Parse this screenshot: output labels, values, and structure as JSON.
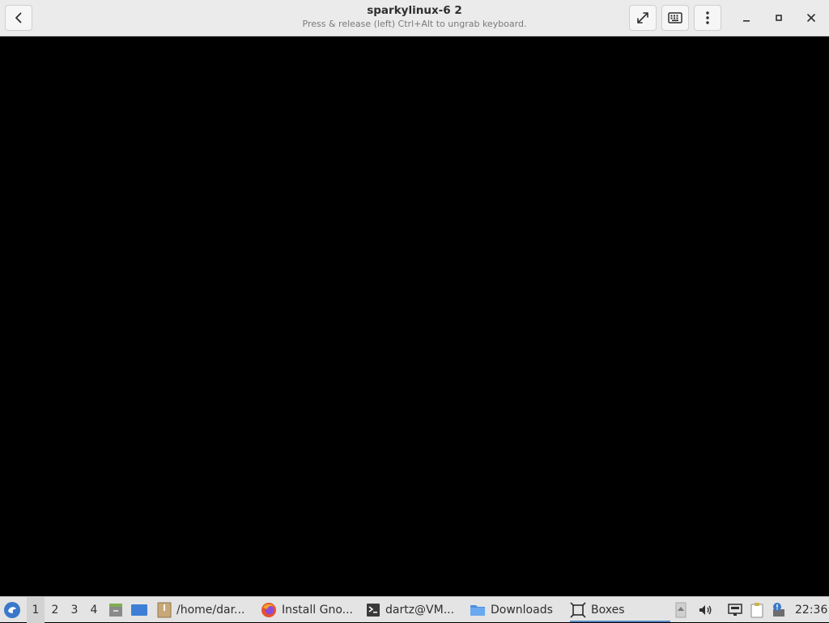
{
  "window": {
    "title": "sparkylinux-6 2",
    "subtitle": "Press & release (left) Ctrl+Alt to ungrab keyboard."
  },
  "header_buttons": {
    "back_icon": "chevron-left-icon",
    "fullscreen_icon": "fullscreen-icon",
    "keyboard_icon": "keyboard-icon",
    "menu_icon": "vertical-dots-icon"
  },
  "window_controls": {
    "minimize_icon": "minimize-icon",
    "maximize_icon": "maximize-icon",
    "close_icon": "close-icon"
  },
  "taskbar": {
    "workspaces": [
      "1",
      "2",
      "3",
      "4"
    ],
    "active_workspace": "1",
    "tasks": [
      {
        "label": "/home/dar...",
        "icon": "archive-icon"
      },
      {
        "label": "Install Gno...",
        "icon": "firefox-icon"
      },
      {
        "label": "dartz@VM...",
        "icon": "terminal-icon"
      },
      {
        "label": "Downloads",
        "icon": "folder-icon"
      },
      {
        "label": "Boxes",
        "icon": "boxes-icon",
        "active": true
      }
    ],
    "clock": "22:36"
  },
  "colors": {
    "headerbar_bg": "#ebebeb",
    "taskbar_bg": "#e4e4e4",
    "vm_bg": "#000000",
    "accent": "#5a8cc8"
  }
}
